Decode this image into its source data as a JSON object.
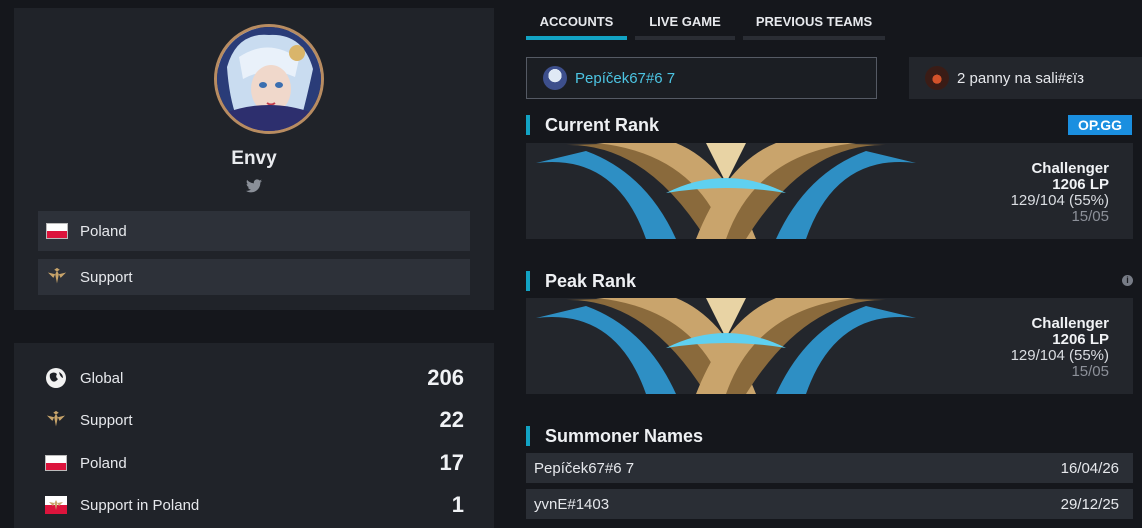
{
  "profile": {
    "name": "Envy",
    "social_icon": "twitter-icon",
    "country": {
      "label": "Poland",
      "flag_colors": [
        "#ffffff",
        "#dc143c"
      ]
    },
    "role": {
      "label": "Support",
      "icon": "support-role-icon"
    }
  },
  "rankings": [
    {
      "label": "Global",
      "value": "206",
      "icon": "globe-icon"
    },
    {
      "label": "Support",
      "value": "22",
      "icon": "support-role-icon"
    },
    {
      "label": "Poland",
      "value": "17",
      "icon": "poland-flag-icon"
    },
    {
      "label": "Support in Poland",
      "value": "1",
      "icon": "support-poland-flag-icon"
    }
  ],
  "tabs": [
    {
      "label": "ACCOUNTS",
      "active": true
    },
    {
      "label": "LIVE GAME",
      "active": false
    },
    {
      "label": "PREVIOUS TEAMS",
      "active": false
    }
  ],
  "accounts": {
    "main": "Pepíček67#6 7",
    "alt": "2 panny na sali#εїз"
  },
  "current_rank": {
    "title": "Current Rank",
    "badge": "OP.GG",
    "tier": "Challenger",
    "lp": "1206 LP",
    "winloss": "129/104 (55%)",
    "date": "15/05"
  },
  "peak_rank": {
    "title": "Peak Rank",
    "info_icon": "info-icon",
    "tier": "Challenger",
    "lp": "1206 LP",
    "winloss": "129/104 (55%)",
    "date": "15/05"
  },
  "summoner_names": {
    "title": "Summoner Names",
    "rows": [
      {
        "name": "Pepíček67#6 7",
        "date": "16/04/26"
      },
      {
        "name": "yvnE#1403",
        "date": "29/12/25"
      }
    ]
  },
  "colors": {
    "accent": "#12a3c4",
    "opgg": "#1a8fe0",
    "link": "#4cc4e2"
  }
}
